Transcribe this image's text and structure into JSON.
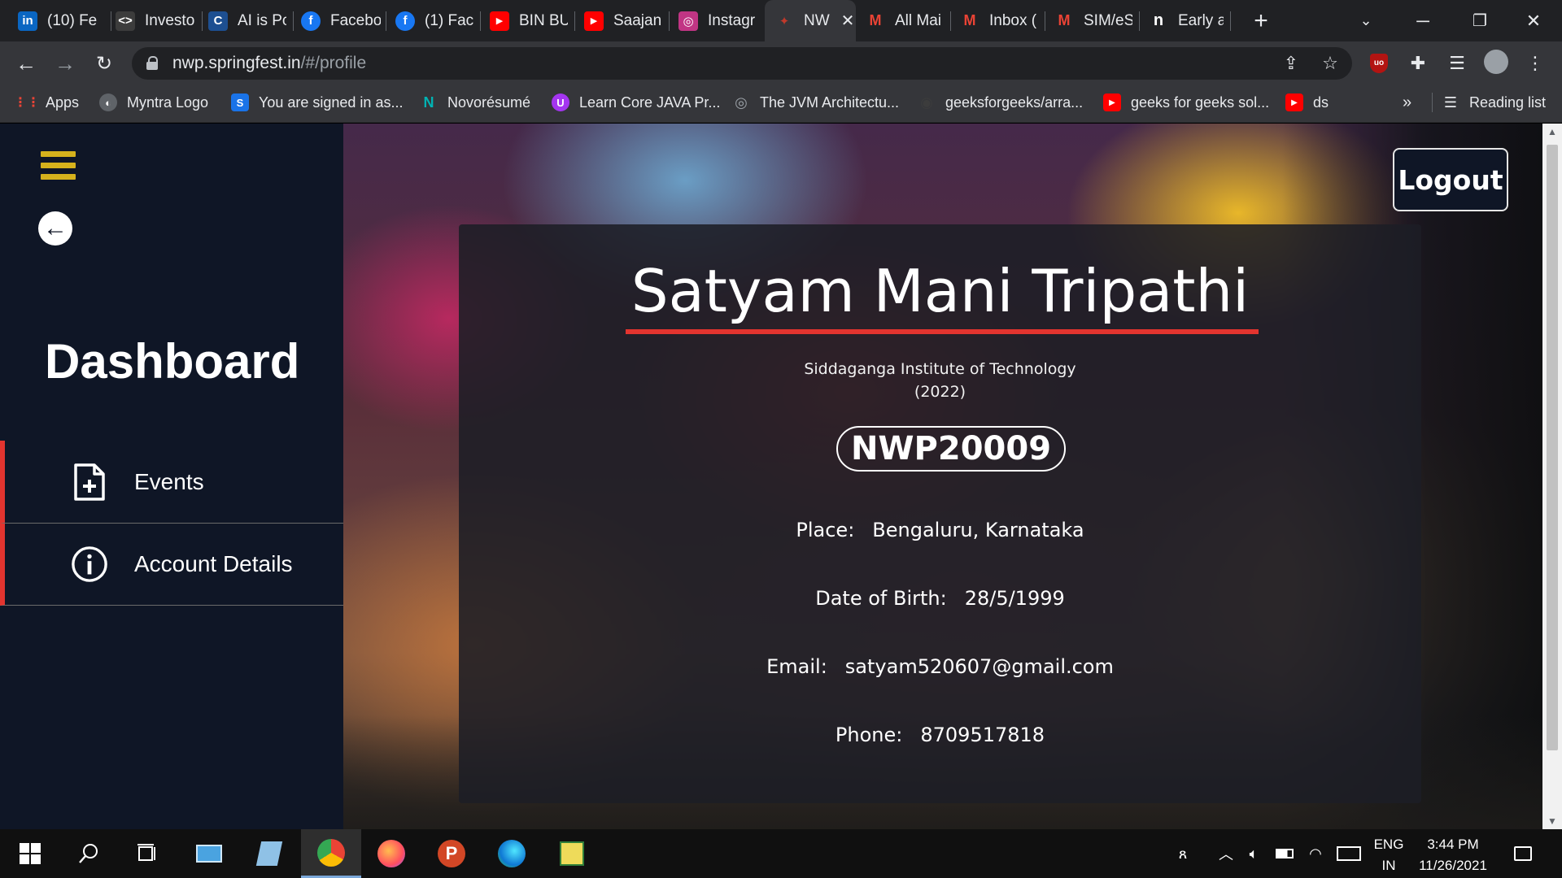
{
  "browser": {
    "tabs": [
      {
        "title": "(10) Fe",
        "icon": "linkedin-icon",
        "color": "#0a66c2",
        "glyph": "in"
      },
      {
        "title": "Investo",
        "icon": "code-icon",
        "color": "#3c3c3c",
        "glyph": "<>"
      },
      {
        "title": "AI is Pc",
        "icon": "cxo-icon",
        "color": "#1d4f91",
        "glyph": "C"
      },
      {
        "title": "Facebo",
        "icon": "facebook-icon",
        "color": "#1877f2",
        "glyph": "f"
      },
      {
        "title": "(1) Fac",
        "icon": "facebook-icon",
        "color": "#1877f2",
        "glyph": "f"
      },
      {
        "title": "BIN BU",
        "icon": "youtube-icon",
        "color": "#ff0000",
        "glyph": "▶"
      },
      {
        "title": "Saajan",
        "icon": "youtube-icon",
        "color": "#ff0000",
        "glyph": "▶"
      },
      {
        "title": "Instagr",
        "icon": "instagram-icon",
        "color": "#c13584",
        "glyph": "◎"
      },
      {
        "title": "NW",
        "icon": "springfest-icon",
        "color": "#c0392b",
        "glyph": "✦"
      },
      {
        "title": "All Mai",
        "icon": "gmail-icon",
        "color": "#ea4335",
        "glyph": "M"
      },
      {
        "title": "Inbox (",
        "icon": "gmail-icon",
        "color": "#ea4335",
        "glyph": "M"
      },
      {
        "title": "SIM/eS",
        "icon": "gmail-icon",
        "color": "#ea4335",
        "glyph": "M"
      },
      {
        "title": "Early a",
        "icon": "notion-icon",
        "color": "#202124",
        "glyph": "n"
      }
    ],
    "new_tab": "+",
    "url_host": "nwp.springfest.in",
    "url_path": "/#/profile",
    "bookmarks": [
      {
        "label": "Apps",
        "icon": "apps-grid-icon",
        "color": "#ea4335",
        "glyph": "⋮⋮"
      },
      {
        "label": "Myntra Logo",
        "icon": "globe-icon",
        "color": "#5f6368",
        "glyph": "◐"
      },
      {
        "label": "You are signed in as...",
        "icon": "s-icon",
        "color": "#1a73e8",
        "glyph": "S"
      },
      {
        "label": "Novorésumé",
        "icon": "novoresume-icon",
        "color": "#00a3a3",
        "glyph": "N"
      },
      {
        "label": "Learn Core JAVA Pr...",
        "icon": "udemy-icon",
        "color": "#a435f0",
        "glyph": "U"
      },
      {
        "label": "The JVM Architectu...",
        "icon": "globe-icon",
        "color": "#5f6368",
        "glyph": "◎"
      },
      {
        "label": "geeksforgeeks/arra...",
        "icon": "github-icon",
        "color": "#3c3c3c",
        "glyph": "◉"
      },
      {
        "label": "geeks for geeks sol...",
        "icon": "youtube-icon",
        "color": "#ff0000",
        "glyph": "▶"
      },
      {
        "label": "ds",
        "icon": "youtube-icon",
        "color": "#ff0000",
        "glyph": "▶"
      }
    ],
    "more_bookmarks": "»",
    "reading_list": "Reading list"
  },
  "sidebar": {
    "title": "Dashboard",
    "items": [
      {
        "label": "Events",
        "icon": "file-plus-icon"
      },
      {
        "label": "Account Details",
        "icon": "info-icon"
      }
    ]
  },
  "header": {
    "logout_label": "Logout"
  },
  "profile": {
    "name": "Satyam Mani Tripathi",
    "college": "Siddaganga Institute of Technology",
    "year": "(2022)",
    "participant_id": "NWP20009",
    "fields": [
      {
        "label": "Place:",
        "value": "Bengaluru, Karnataka"
      },
      {
        "label": "Date of Birth:",
        "value": "28/5/1999"
      },
      {
        "label": "Email:",
        "value": "satyam520607@gmail.com"
      },
      {
        "label": "Phone:",
        "value": "8709517818"
      }
    ]
  },
  "taskbar": {
    "language_line1": "ENG",
    "language_line2": "IN",
    "time": "3:44 PM",
    "date": "11/26/2021"
  },
  "colors": {
    "accent_red": "#e3342f",
    "hamburger_yellow": "#d6b21c",
    "sidebar_bg": "#0f1626"
  }
}
